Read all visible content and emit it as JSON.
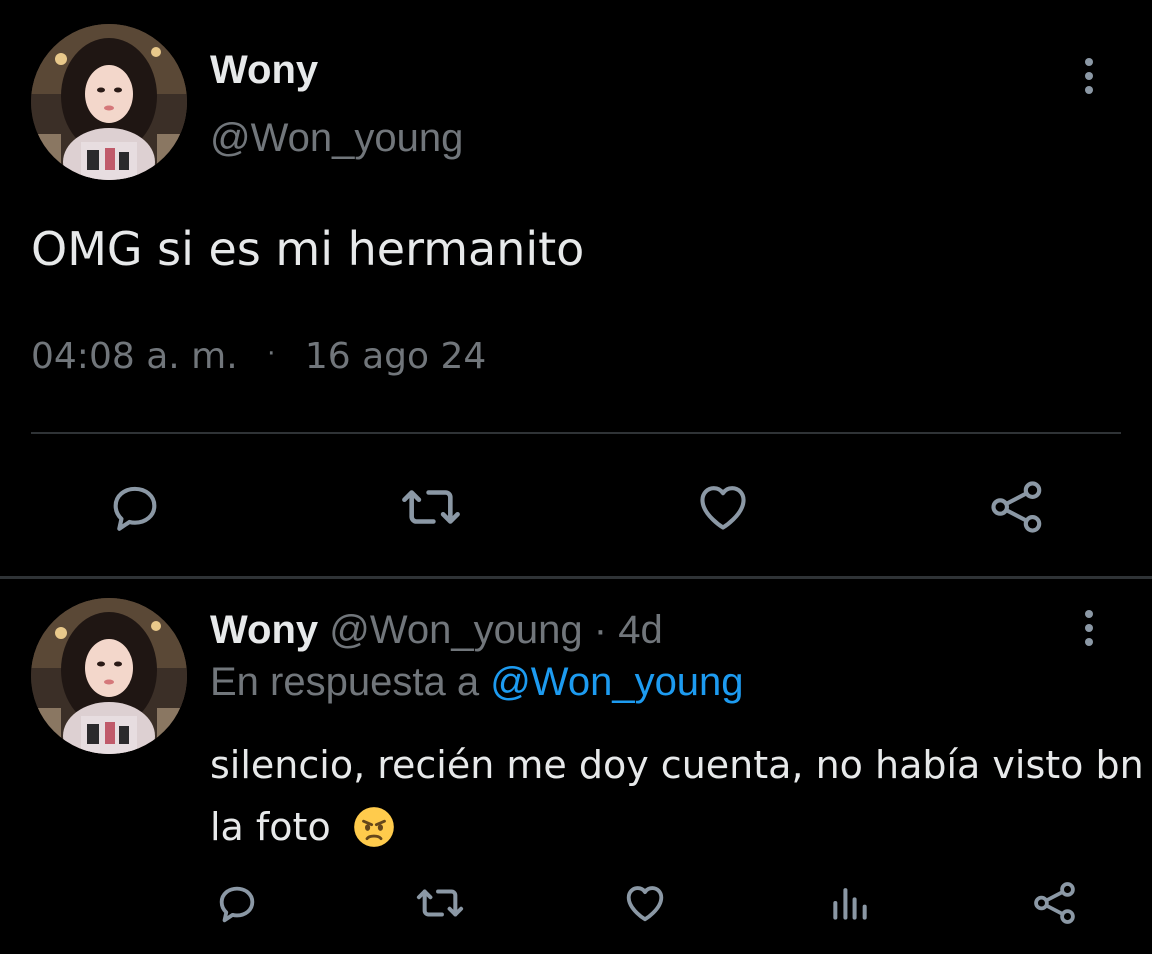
{
  "main_tweet": {
    "display_name": "Wony",
    "handle": "@Won_young",
    "text": "OMG si es mi hermanito",
    "time": "04:08 a. m.",
    "separator": "·",
    "date": "16 ago 24",
    "avatar_icon": "profile-photo",
    "menu_icon": "more-vertical-icon",
    "actions": [
      "reply-icon",
      "retweet-icon",
      "like-icon",
      "share-icon"
    ]
  },
  "reply_tweet": {
    "display_name": "Wony",
    "handle": "@Won_young",
    "separator": "·",
    "age": "4d",
    "reply_prefix": "En respuesta a",
    "reply_to": "@Won_young",
    "text_line1": "silencio, recién me doy cuenta, no había visto bn",
    "text_line2": "la foto",
    "emoji": "angry-face-emoji",
    "menu_icon": "more-vertical-icon",
    "actions": [
      "reply-icon",
      "retweet-icon",
      "like-icon",
      "views-icon",
      "share-icon"
    ]
  },
  "colors": {
    "background": "#000000",
    "text_primary": "#e7e9ea",
    "text_secondary": "#71767b",
    "link": "#1d9bf0",
    "divider": "#2f3336",
    "icon": "#8b98a5"
  }
}
